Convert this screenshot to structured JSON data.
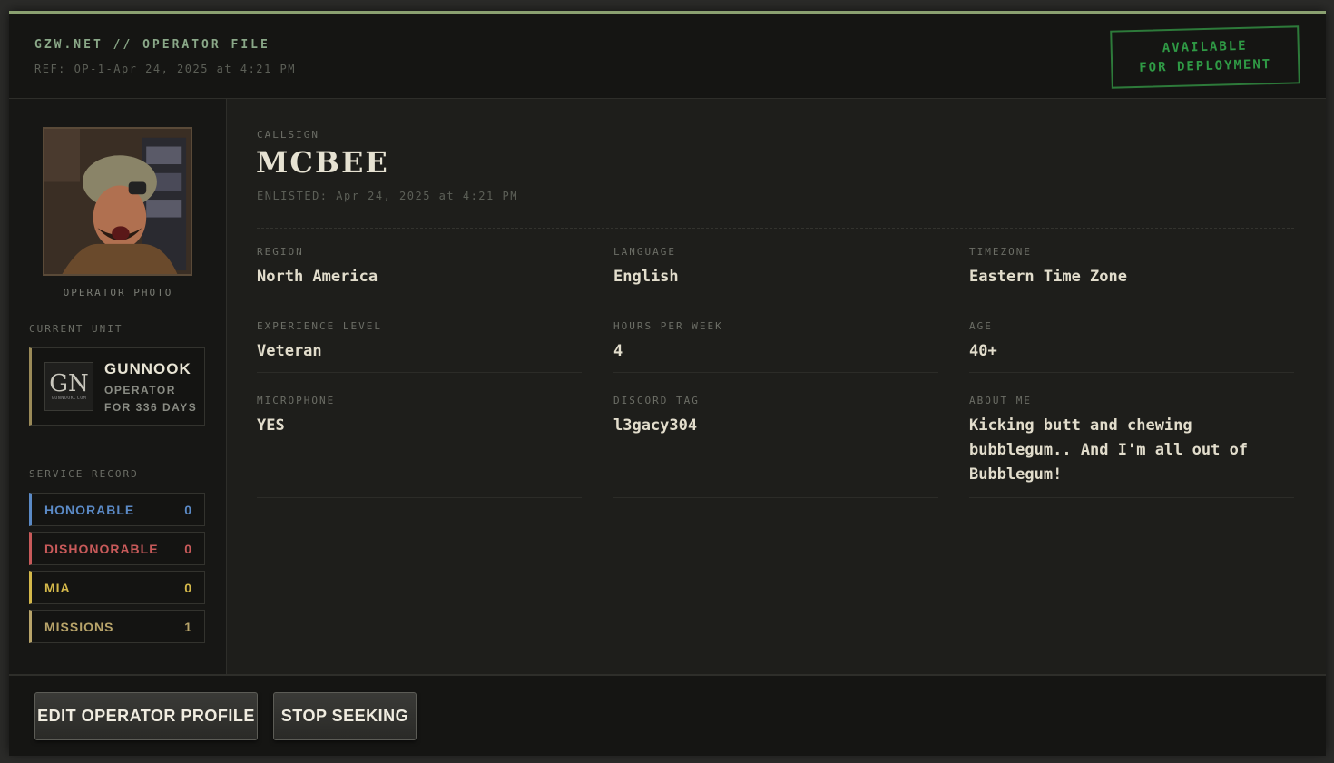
{
  "header": {
    "title": "GZW.NET // OPERATOR FILE",
    "ref": "REF: OP-1-Apr 24, 2025 at 4:21 PM",
    "status_stamp": "AVAILABLE\nFOR DEPLOYMENT"
  },
  "sidebar": {
    "photo_caption": "OPERATOR PHOTO",
    "current_unit_label": "CURRENT UNIT",
    "unit": {
      "logo_text": "GN",
      "logo_small": "GUNNOOK.COM",
      "name": "GUNNOOK",
      "role": "OPERATOR",
      "tenure": "FOR 336 DAYS"
    },
    "service_record_label": "SERVICE RECORD",
    "records": [
      {
        "label": "HONORABLE",
        "value": "0",
        "color": "#5b8ac6"
      },
      {
        "label": "DISHONORABLE",
        "value": "0",
        "color": "#c85a5a"
      },
      {
        "label": "MIA",
        "value": "0",
        "color": "#d4b84a"
      },
      {
        "label": "MISSIONS",
        "value": "1",
        "color": "#b8a46a"
      }
    ]
  },
  "profile": {
    "callsign_label": "CALLSIGN",
    "callsign": "MCBEE",
    "enlisted": "ENLISTED: Apr 24, 2025 at 4:21 PM",
    "fields": [
      {
        "label": "REGION",
        "value": "North America"
      },
      {
        "label": "LANGUAGE",
        "value": "English"
      },
      {
        "label": "TIMEZONE",
        "value": "Eastern Time Zone"
      },
      {
        "label": "EXPERIENCE LEVEL",
        "value": "Veteran"
      },
      {
        "label": "HOURS PER WEEK",
        "value": "4"
      },
      {
        "label": "AGE",
        "value": "40+"
      },
      {
        "label": "MICROPHONE",
        "value": "YES"
      },
      {
        "label": "DISCORD TAG",
        "value": "l3gacy304"
      },
      {
        "label": "ABOUT ME",
        "value": "Kicking butt and chewing bubblegum.. And I'm all out of Bubblegum!"
      }
    ]
  },
  "footer": {
    "edit_label": "EDIT OPERATOR PROFILE",
    "stop_label": "STOP SEEKING"
  },
  "colors": {
    "accent": "#8aa070",
    "stamp": "#2f9a45"
  }
}
